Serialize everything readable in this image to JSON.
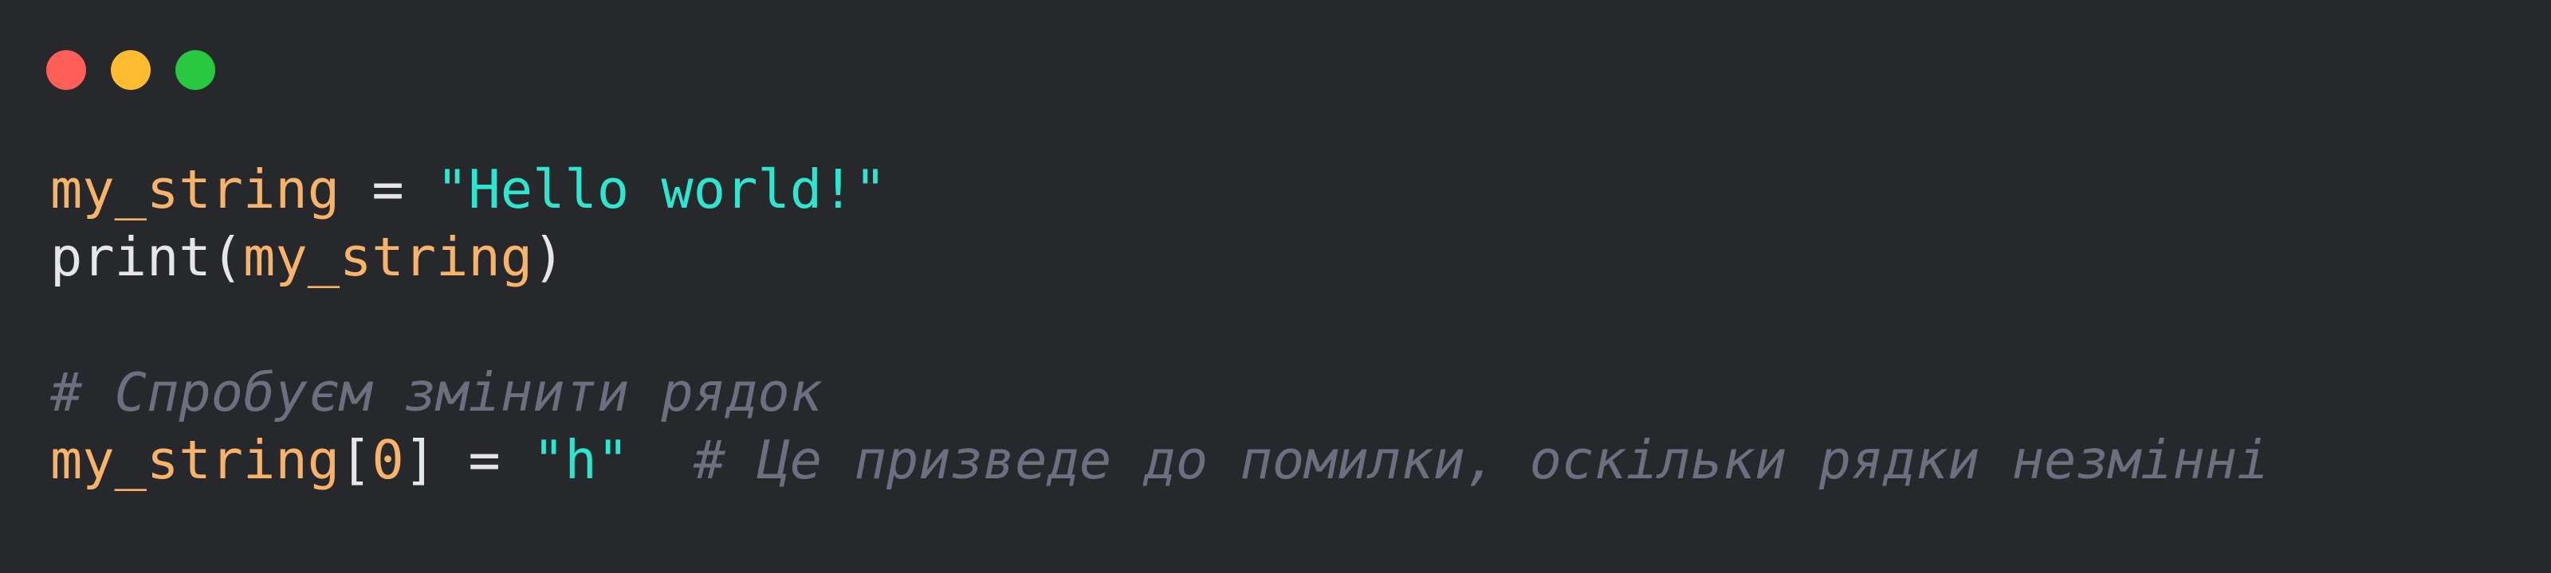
{
  "window": {
    "controls": [
      {
        "name": "close",
        "color": "#ff5f57"
      },
      {
        "name": "minimize",
        "color": "#febc2e"
      },
      {
        "name": "maximize",
        "color": "#28c840"
      }
    ]
  },
  "colors": {
    "background": "#27282b",
    "variable": "#f7b36a",
    "string": "#2ee6d0",
    "comment": "#6c6f7d",
    "default": "#e6e6e6"
  },
  "code": {
    "line1": {
      "var": "my_string",
      "op": " = ",
      "str": "\"Hello world!\""
    },
    "line2": {
      "fn": "print",
      "open": "(",
      "arg": "my_string",
      "close": ")"
    },
    "line3": {
      "text": ""
    },
    "line4": {
      "comment": "# Спробуєм змінити рядок"
    },
    "line5": {
      "var": "my_string",
      "open": "[",
      "num": "0",
      "close": "]",
      "op": " = ",
      "str": "\"h\"",
      "gap": "  ",
      "comment": "# Це призведе до помилки, оскільки рядки незмінні"
    }
  }
}
